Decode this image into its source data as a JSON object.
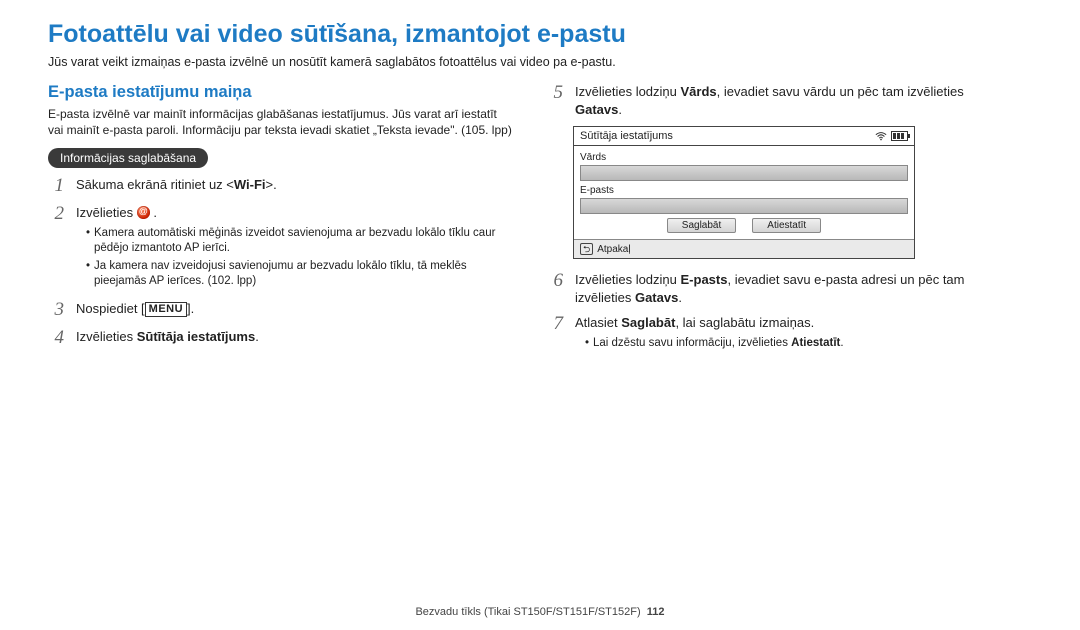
{
  "title": "Fotoattēlu vai video sūtīšana, izmantojot e-pastu",
  "subtitle": "Jūs varat veikt izmaiņas e-pasta izvēlnē un nosūtīt kamerā saglabātos fotoattēlus vai video pa e-pastu.",
  "left": {
    "section_h": "E-pasta iestatījumu maiņa",
    "para": "E-pasta izvēlnē var mainīt informācijas glabāšanas iestatījumus. Jūs varat arī iestatīt vai mainīt e-pasta paroli. Informāciju par teksta ievadi skatiet „Teksta ievade\". (105. lpp)",
    "pill": "Informācijas saglabāšana",
    "step1": {
      "num": "1",
      "pre": "Sākuma ekrānā ritiniet uz <",
      "bold": "Wi-Fi",
      "post": ">."
    },
    "step2": {
      "num": "2",
      "text": "Izvēlieties",
      "sub1": "Kamera automātiski mēģinās izveidot savienojuma ar bezvadu lokālo tīklu caur pēdējo izmantoto AP ierīci.",
      "sub2": "Ja kamera nav izveidojusi savienojumu ar bezvadu lokālo tīklu, tā meklēs pieejamās AP ierīces. (102. lpp)"
    },
    "step3": {
      "num": "3",
      "pre": "Nospiediet [",
      "menu": "MENU",
      "post": "]."
    },
    "step4": {
      "num": "4",
      "pre": "Izvēlieties ",
      "bold": "Sūtītāja iestatījums",
      "post": "."
    }
  },
  "right": {
    "step5": {
      "num": "5",
      "pre": "Izvēlieties lodziņu ",
      "bold1": "Vārds",
      "mid": ", ievadiet savu vārdu un pēc tam izvēlieties ",
      "bold2": "Gatavs",
      "post": "."
    },
    "dialog": {
      "title": "Sūtītāja iestatījums",
      "label1": "Vārds",
      "label2": "E-pasts",
      "btn_save": "Saglabāt",
      "btn_reset": "Atiestatīt",
      "back": "Atpakaļ"
    },
    "step6": {
      "num": "6",
      "pre": "Izvēlieties lodziņu ",
      "bold1": "E-pasts",
      "mid": ", ievadiet savu e-pasta adresi un pēc tam izvēlieties ",
      "bold2": "Gatavs",
      "post": "."
    },
    "step7": {
      "num": "7",
      "pre": "Atlasiet ",
      "bold": "Saglabāt",
      "post": ", lai saglabātu izmaiņas.",
      "sub1a": "Lai dzēstu savu informāciju, izvēlieties ",
      "sub1b": "Atiestatīt",
      "sub1c": "."
    }
  },
  "footer": {
    "section": "Bezvadu tīkls (Tikai ST150F/ST151F/ST152F)",
    "page": "112"
  }
}
